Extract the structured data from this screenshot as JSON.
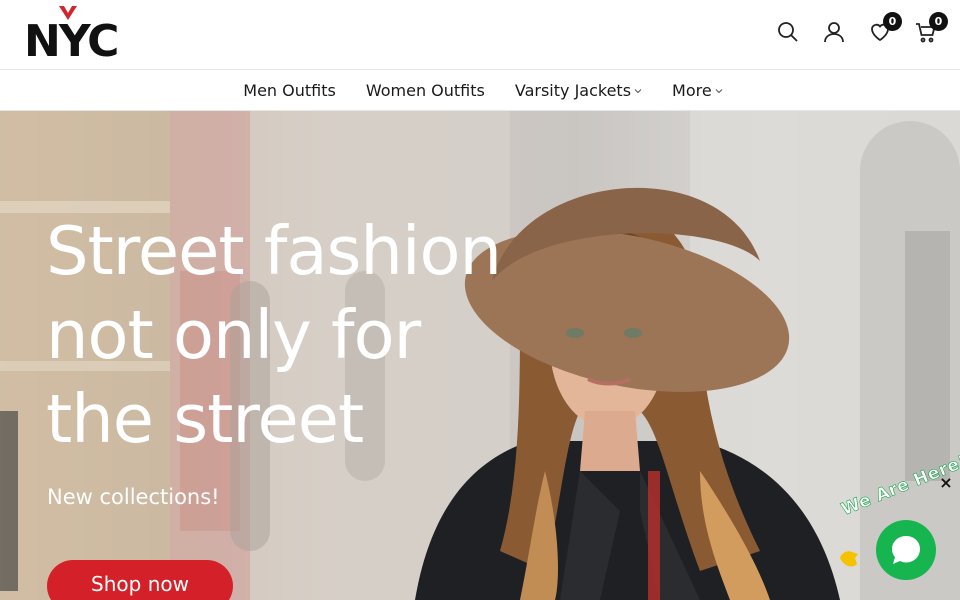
{
  "header": {
    "logo": "NYC",
    "icons": [
      "search-icon",
      "user-icon",
      "heart-icon",
      "cart-icon"
    ],
    "wishlist_count": "0",
    "cart_count": "0"
  },
  "nav": {
    "items": [
      {
        "label": "Men Outfits",
        "dropdown": false
      },
      {
        "label": "Women Outfits",
        "dropdown": false
      },
      {
        "label": "Varsity Jackets",
        "dropdown": true
      },
      {
        "label": "More",
        "dropdown": true
      }
    ]
  },
  "hero": {
    "title_lines": [
      "Street fashion",
      "not only for",
      "the street"
    ],
    "subtitle": "New collections!",
    "button_label": "Shop now"
  },
  "chat": {
    "label": "We Are Here!",
    "close": "×"
  },
  "colors": {
    "accent": "#d42129",
    "chat_green": "#16b54f",
    "badge": "#111111"
  }
}
